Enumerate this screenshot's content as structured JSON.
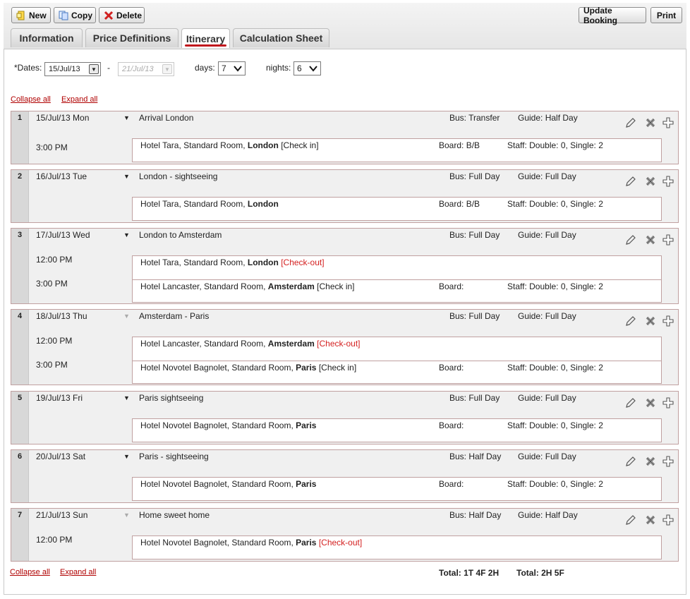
{
  "toolbar": {
    "new_label": "New",
    "copy_label": "Copy",
    "delete_label": "Delete",
    "update_label": "Update Booking",
    "print_label": "Print"
  },
  "tabs": [
    {
      "label": "Information"
    },
    {
      "label": "Price Definitions"
    },
    {
      "label": "Itinerary"
    },
    {
      "label": "Calculation Sheet"
    }
  ],
  "active_tab": "Itinerary",
  "dates": {
    "label": "*Dates:",
    "start": "15/Jul/13",
    "separator": "-",
    "end": "21/Jul/13",
    "days_label": "days:",
    "days_value": "7",
    "nights_label": "nights:",
    "nights_value": "6"
  },
  "links": {
    "collapse": "Collapse all",
    "expand": "Expand all"
  },
  "days": [
    {
      "num": "1",
      "date": "15/Jul/13 Mon",
      "title": "Arrival London",
      "bus": "Bus: Transfer",
      "guide": "Guide: Half Day",
      "entries": [
        {
          "time": "3:00 PM",
          "hotel": "Hotel Tara, Standard Room, ",
          "city": "London",
          "status": "[Check in]",
          "board": "Board: B/B",
          "staff": "Staff: Double: 0, Single: 2"
        }
      ]
    },
    {
      "num": "2",
      "date": "16/Jul/13 Tue",
      "title": "London - sightseeing",
      "bus": "Bus: Full Day",
      "guide": "Guide: Full Day",
      "entries": [
        {
          "time": "",
          "hotel": "Hotel Tara, Standard Room, ",
          "city": "London",
          "status": "",
          "board": "Board: B/B",
          "staff": "Staff: Double: 0, Single: 2"
        }
      ]
    },
    {
      "num": "3",
      "date": "17/Jul/13 Wed",
      "title": "London to Amsterdam",
      "bus": "Bus: Full Day",
      "guide": "Guide: Full Day",
      "entries": [
        {
          "time": "12:00 PM",
          "hotel": "Hotel Tara, Standard Room, ",
          "city": "London",
          "status": "[Check-out]",
          "board": "",
          "staff": ""
        },
        {
          "time": "3:00 PM",
          "hotel": "Hotel Lancaster, Standard Room, ",
          "city": "Amsterdam",
          "status": "[Check in]",
          "board": "Board:",
          "staff": "Staff: Double: 0, Single: 2"
        }
      ]
    },
    {
      "num": "4",
      "date": "18/Jul/13 Thu",
      "title": "Amsterdam - Paris",
      "bus": "Bus: Full Day",
      "guide": "Guide: Full Day",
      "entries": [
        {
          "time": "12:00 PM",
          "hotel": "Hotel Lancaster, Standard Room, ",
          "city": "Amsterdam",
          "status": "[Check-out]",
          "board": "",
          "staff": ""
        },
        {
          "time": "3:00 PM",
          "hotel": "Hotel Novotel Bagnolet, Standard Room, ",
          "city": "Paris",
          "status": "[Check in]",
          "board": "Board:",
          "staff": "Staff: Double: 0, Single: 2"
        }
      ]
    },
    {
      "num": "5",
      "date": "19/Jul/13 Fri",
      "title": "Paris sightseeing",
      "bus": "Bus: Full Day",
      "guide": "Guide: Full Day",
      "entries": [
        {
          "time": "",
          "hotel": "Hotel Novotel Bagnolet, Standard Room, ",
          "city": "Paris",
          "status": "",
          "board": "Board:",
          "staff": "Staff: Double: 0, Single: 2"
        }
      ]
    },
    {
      "num": "6",
      "date": "20/Jul/13 Sat",
      "title": "Paris - sightseeing",
      "bus": "Bus: Half Day",
      "guide": "Guide: Full Day",
      "entries": [
        {
          "time": "",
          "hotel": "Hotel Novotel Bagnolet, Standard Room, ",
          "city": "Paris",
          "status": "",
          "board": "Board:",
          "staff": "Staff: Double: 0, Single: 2"
        }
      ]
    },
    {
      "num": "7",
      "date": "21/Jul/13 Sun",
      "title": "Home sweet home",
      "bus": "Bus: Half Day",
      "guide": "Guide: Half Day",
      "entries": [
        {
          "time": "12:00 PM",
          "hotel": "Hotel Novotel Bagnolet, Standard Room, ",
          "city": "Paris",
          "status": "[Check-out]",
          "board": "",
          "staff": ""
        }
      ]
    }
  ],
  "totals": {
    "left": "Total: 1T 4F 2H",
    "right": "Total: 2H 5F"
  },
  "colors": {
    "link": "#b00000",
    "checkout": "#d42020",
    "tab_underline": "#c0161c"
  }
}
